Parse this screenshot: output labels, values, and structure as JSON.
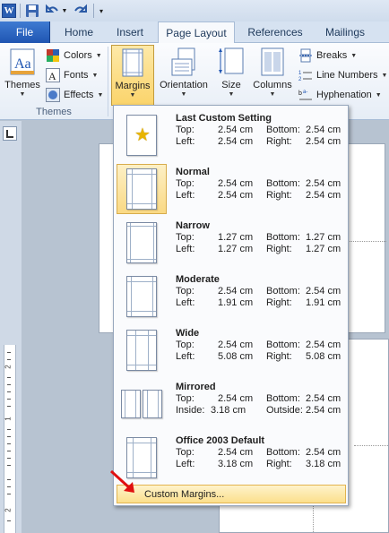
{
  "tabs": {
    "file": "File",
    "home": "Home",
    "insert": "Insert",
    "page_layout": "Page Layout",
    "references": "References",
    "mailings": "Mailings"
  },
  "qat": {
    "logo": "W"
  },
  "ribbon": {
    "themes_label": "Themes",
    "themes_group": "Themes",
    "colors": "Colors",
    "fonts": "Fonts",
    "effects": "Effects",
    "margins": "Margins",
    "orientation": "Orientation",
    "size": "Size",
    "columns": "Columns",
    "breaks": "Breaks",
    "line_numbers": "Line Numbers",
    "hyphenation": "Hyphenation"
  },
  "ruler": {
    "marks": [
      "2",
      "1",
      "2"
    ]
  },
  "margins_menu": {
    "items": [
      {
        "title": "Last Custom Setting",
        "l1": "Top:",
        "v1": "2.54 cm",
        "l2": "Bottom:",
        "v2": "2.54 cm",
        "l3": "Left:",
        "v3": "2.54 cm",
        "l4": "Right:",
        "v4": "2.54 cm"
      },
      {
        "title": "Normal",
        "l1": "Top:",
        "v1": "2.54 cm",
        "l2": "Bottom:",
        "v2": "2.54 cm",
        "l3": "Left:",
        "v3": "2.54 cm",
        "l4": "Right:",
        "v4": "2.54 cm"
      },
      {
        "title": "Narrow",
        "l1": "Top:",
        "v1": "1.27 cm",
        "l2": "Bottom:",
        "v2": "1.27 cm",
        "l3": "Left:",
        "v3": "1.27 cm",
        "l4": "Right:",
        "v4": "1.27 cm"
      },
      {
        "title": "Moderate",
        "l1": "Top:",
        "v1": "2.54 cm",
        "l2": "Bottom:",
        "v2": "2.54 cm",
        "l3": "Left:",
        "v3": "1.91 cm",
        "l4": "Right:",
        "v4": "1.91 cm"
      },
      {
        "title": "Wide",
        "l1": "Top:",
        "v1": "2.54 cm",
        "l2": "Bottom:",
        "v2": "2.54 cm",
        "l3": "Left:",
        "v3": "5.08 cm",
        "l4": "Right:",
        "v4": "5.08 cm"
      },
      {
        "title": "Mirrored",
        "l1": "Top:",
        "v1": "2.54 cm",
        "l2": "Bottom:",
        "v2": "2.54 cm",
        "l3": "Inside:",
        "v3": "3.18 cm",
        "l4": "Outside:",
        "v4": "2.54 cm"
      },
      {
        "title": "Office 2003 Default",
        "l1": "Top:",
        "v1": "2.54 cm",
        "l2": "Bottom:",
        "v2": "2.54 cm",
        "l3": "Left:",
        "v3": "3.18 cm",
        "l4": "Right:",
        "v4": "3.18 cm"
      }
    ],
    "custom": "Custom Margins..."
  },
  "colors": {
    "accent": "#1f55b2",
    "highlight": "#fbd46b",
    "arrow": "#e01010"
  }
}
